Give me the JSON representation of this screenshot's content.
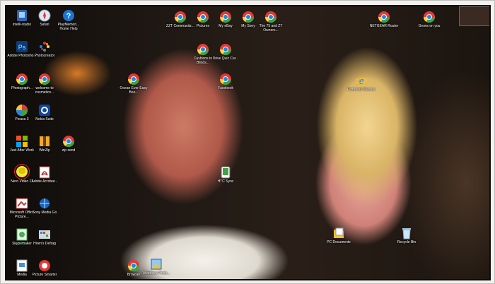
{
  "desktop": {
    "icons": [
      {
        "label": "intelli-studio",
        "icon": "app-icon"
      },
      {
        "label": "Safari",
        "icon": "safari-icon"
      },
      {
        "label": "PlayMemori... Home Help",
        "icon": "help-icon"
      },
      {
        "label": "ZZT Communitz...",
        "icon": "chrome-icon"
      },
      {
        "label": "Pictures",
        "icon": "chrome-icon"
      },
      {
        "label": "My eBay",
        "icon": "chrome-icon"
      },
      {
        "label": "My Sony",
        "icon": "chrome-icon"
      },
      {
        "label": "The 75 and ZT Owners...",
        "icon": "chrome-icon"
      },
      {
        "label": "NETGEAR Router",
        "icon": "chrome-icon"
      },
      {
        "label": "Grows on you",
        "icon": "chrome-icon"
      },
      {
        "label": "Adobe Photosho...",
        "icon": "photoshop-icon"
      },
      {
        "label": "Photocreator",
        "icon": "pinwheel-icon"
      },
      {
        "label": "Cushions to Blinds...",
        "icon": "chrome-icon"
      },
      {
        "label": "Drive Quiz Car...",
        "icon": "chrome-icon"
      },
      {
        "label": "Photograph...",
        "icon": "chrome-icon"
      },
      {
        "label": "welcome to cosmetics...",
        "icon": "chrome-icon"
      },
      {
        "label": "Ocean Ever Easy Boo...",
        "icon": "chrome-icon"
      },
      {
        "label": "Facebook",
        "icon": "chrome-icon"
      },
      {
        "label": "Pictures3 Cleaner",
        "icon": "ie-icon"
      },
      {
        "label": "Picasa 3",
        "icon": "picasa-icon"
      },
      {
        "label": "Nokia Suite",
        "icon": "nokia-icon"
      },
      {
        "label": "Just After Work",
        "icon": "windows-icon"
      },
      {
        "label": "WinZip",
        "icon": "winzip-icon"
      },
      {
        "label": "zip send",
        "icon": "chrome-icon"
      },
      {
        "label": "Nero Video 11",
        "icon": "nero-icon"
      },
      {
        "label": "Adobe Acrobat...",
        "icon": "acrobat-icon"
      },
      {
        "label": "HTC Sync",
        "icon": "htc-icon"
      },
      {
        "label": "Microsoft Office Picture...",
        "icon": "picture-manager-icon"
      },
      {
        "label": "Sony Media Go",
        "icon": "network-icon"
      },
      {
        "label": "Hiren's Defrag",
        "icon": "defrag-icon"
      },
      {
        "label": "Windows Photo...",
        "icon": "windows-icon"
      },
      {
        "label": "PC Documents",
        "icon": "document-icon"
      },
      {
        "label": "Recycle Bin",
        "icon": "recycle-bin-icon"
      },
      {
        "label": "Skypemaker",
        "icon": "file-icon"
      },
      {
        "label": "Browser",
        "icon": "chrome-icon"
      },
      {
        "label": "Media",
        "icon": "windows-icon"
      },
      {
        "label": "Picture Smarter",
        "icon": "picture-icon"
      }
    ]
  },
  "colors": {
    "frame": "#f4f1ed",
    "highlight": "#ff2020"
  }
}
